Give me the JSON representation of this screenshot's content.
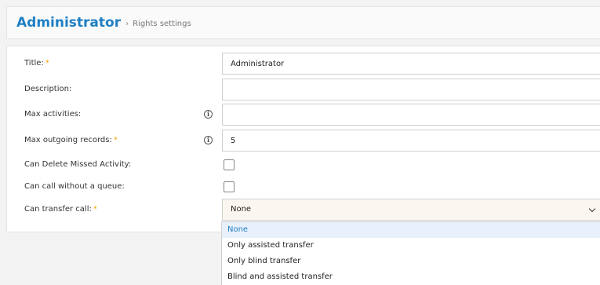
{
  "header": {
    "title": "Administrator",
    "separator": "›",
    "breadcrumb": "Rights settings"
  },
  "form": {
    "title_label": "Title:",
    "title_value": "Administrator",
    "description_label": "Description:",
    "description_value": "",
    "max_activities_label": "Max activities:",
    "max_activities_value": "",
    "max_outgoing_label": "Max outgoing records:",
    "max_outgoing_value": "5",
    "can_delete_missed_label": "Can Delete Missed Activity:",
    "can_delete_missed_checked": false,
    "can_call_without_queue_label": "Can call without a queue:",
    "can_call_without_queue_checked": false,
    "can_transfer_label": "Can transfer call:",
    "can_transfer_value": "None",
    "required_mark": "*",
    "info_glyph": "i"
  },
  "dropdown": {
    "options": [
      "None",
      "Only assisted transfer",
      "Only blind transfer",
      "Blind and assisted transfer"
    ],
    "selected": "None"
  },
  "colors": {
    "accent": "#1f7fc4",
    "required": "#f0a500"
  },
  "icons": {
    "info": "info-icon",
    "chevron": "chevron-down-icon"
  }
}
